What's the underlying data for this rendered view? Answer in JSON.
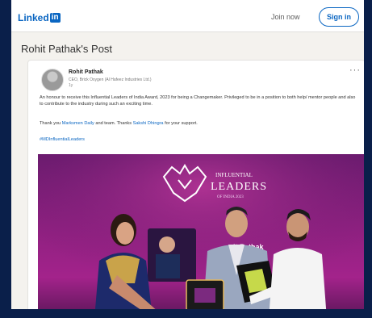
{
  "colors": {
    "brand": "#0a66c2",
    "backdrop": "#0a1f4a",
    "stage": "#8e2080"
  },
  "header": {
    "logo_text": "Linked",
    "logo_badge": "in",
    "join_label": "Join now",
    "signin_label": "Sign in"
  },
  "page": {
    "title": "Rohit Pathak's Post"
  },
  "post": {
    "author": "Rohit Pathak",
    "headline": "CEO, Brick Oxygen (Al Hafeez Industries Ltd.)",
    "time": "1y",
    "more_label": "···",
    "body_1": "An honour to receive this Influential Leaders of India Award, 2023 for being a Changemaker. Privileged to be in a position to both help/ mentor people and also to contribute to the industry during such an exciting time.",
    "body_2_pre": "Thank you ",
    "mention_1": "Marksmen Daily",
    "body_2_mid": " and team. Thanks ",
    "mention_2": "Sakshi Dhingra",
    "body_2_post": " for your support.",
    "hashtag": "#MDInfluentialLeaders",
    "image": {
      "award_title": "INFLUENTIAL LEADERS",
      "award_subtitle": "OF INDIA 2023",
      "screen_name": "Rohit Pathak"
    }
  }
}
